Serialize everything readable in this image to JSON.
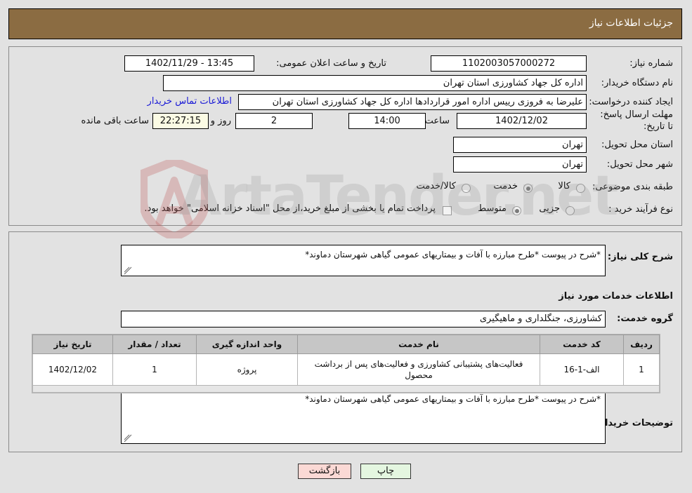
{
  "header": {
    "title": "جزئیات اطلاعات نیاز"
  },
  "top_section": {
    "need_number_label": "شماره نیاز:",
    "need_number_value": "1102003057000272",
    "buyer_org_label": "نام دستگاه خریدار:",
    "buyer_org_value": "اداره کل جهاد کشاورزی استان تهران",
    "creator_label": "ایجاد کننده درخواست:",
    "creator_value": "علیرضا به فروزی رییس اداره امور قراردادها اداره کل جهاد کشاورزی استان تهران",
    "buyer_contact_link": "اطلاعات تماس خریدار",
    "deadline_label": "مهلت ارسال پاسخ: تا تاریخ:",
    "deadline_date": "1402/12/02",
    "hour_label": "ساعت",
    "deadline_time": "14:00",
    "days_remaining": "2",
    "days_label": "روز و",
    "countdown": "22:27:15",
    "countdown_label": "ساعت باقی مانده",
    "announce_label": "تاریخ و ساعت اعلان عمومی:",
    "announce_value": "13:45 - 1402/11/29",
    "province_label": "استان محل تحویل:",
    "province_value": "تهران",
    "city_label": "شهر محل تحویل:",
    "city_value": "تهران",
    "category_label": "طبقه بندی موضوعی:",
    "category_options": [
      "کالا",
      "خدمت",
      "کالا/خدمت"
    ],
    "category_selected": 1,
    "process_label": "نوع فرآیند خرید :",
    "process_options": [
      "جزیی",
      "متوسط"
    ],
    "process_selected": 1,
    "treasury_note": "پرداخت تمام یا بخشی از مبلغ خرید،از محل \"اسناد خزانه اسلامی\" خواهد بود."
  },
  "main_section": {
    "general_desc_label": "شرح کلی نیاز:",
    "general_desc_value": "*شرح در پیوست *طرح مبارزه با آفات و بیمتاریهای عمومی گیاهی شهرستان دماوند*",
    "services_info_heading": "اطلاعات خدمات مورد نیاز",
    "service_group_label": "گروه خدمت:",
    "service_group_value": "کشاورزی، جنگلداری و ماهیگیری",
    "table": {
      "columns": [
        "ردیف",
        "کد خدمت",
        "نام خدمت",
        "واحد اندازه گیری",
        "تعداد / مقدار",
        "تاریخ نیاز"
      ],
      "rows": [
        {
          "row": "1",
          "code": "الف-1-16",
          "name": "فعالیت‌های پشتیبانی کشاورزی و فعالیت‌های پس از برداشت محصول",
          "unit": "پروژه",
          "quantity": "1",
          "date": "1402/12/02"
        }
      ]
    },
    "buyer_notes_label": "توضیحات خریدار:",
    "buyer_notes_value": "*شرح در پیوست *طرح مبارزه با آفات و بیمتاریهای عمومی گیاهی شهرستان دماوند*"
  },
  "footer": {
    "print_label": "چاپ",
    "back_label": "بازگشت"
  },
  "watermark": {
    "text": "ArtaTender.net"
  },
  "colors": {
    "header_bg": "#8b6c42",
    "page_bg": "#e2e2e2",
    "link": "#1a1ad6",
    "print_btn": "#e4f6e0",
    "back_btn": "#fbd9d5",
    "countdown_bg": "#fbfbe4",
    "table_header_bg": "#c6c6c6"
  }
}
